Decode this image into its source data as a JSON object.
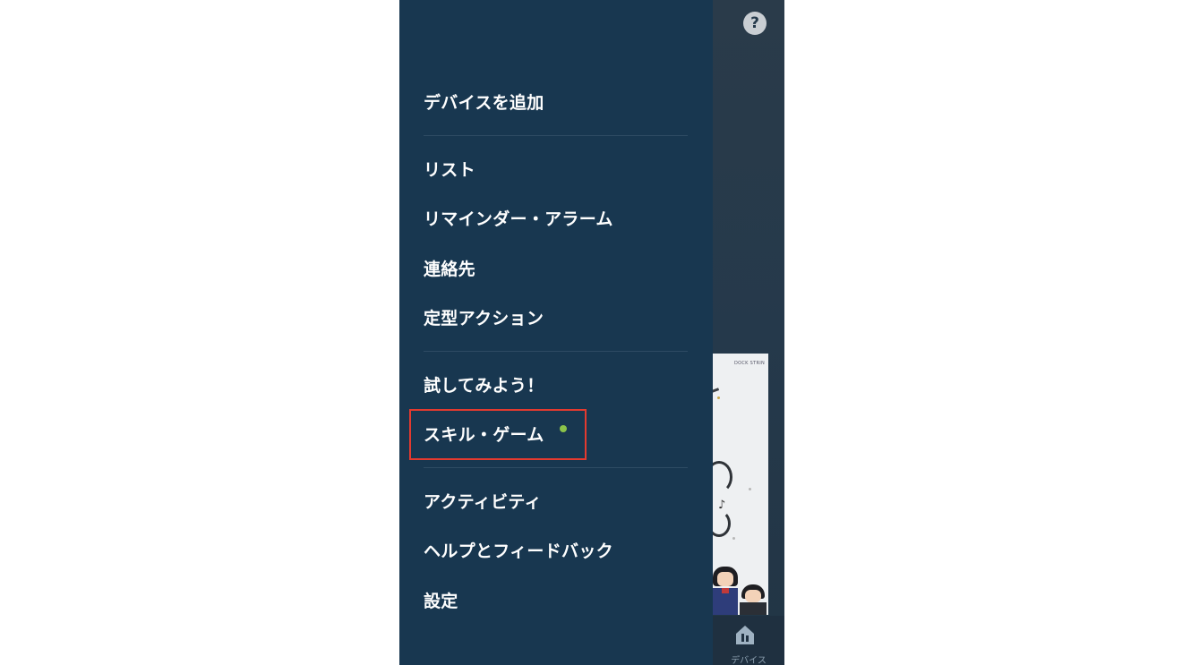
{
  "menu": {
    "add_device": "デバイスを追加",
    "lists": "リスト",
    "reminders_alarms": "リマインダー・アラーム",
    "contacts": "連絡先",
    "routines": "定型アクション",
    "things_to_try": "試してみよう！",
    "skills_games": "スキル・ゲーム",
    "activity": "アクティビティ",
    "help_feedback": "ヘルプとフィードバック",
    "settings": "設定"
  },
  "background": {
    "help_icon": "?",
    "promo_brand": "DOCK STRIN",
    "bottom_nav_label": "デバイス",
    "note_glyph": "♪"
  },
  "colors": {
    "drawer": "#183750",
    "highlight_border": "#e43a2f",
    "new_indicator": "#8bc34a"
  },
  "icons": [
    "help-icon",
    "home-devices-icon",
    "new-indicator-dot"
  ]
}
